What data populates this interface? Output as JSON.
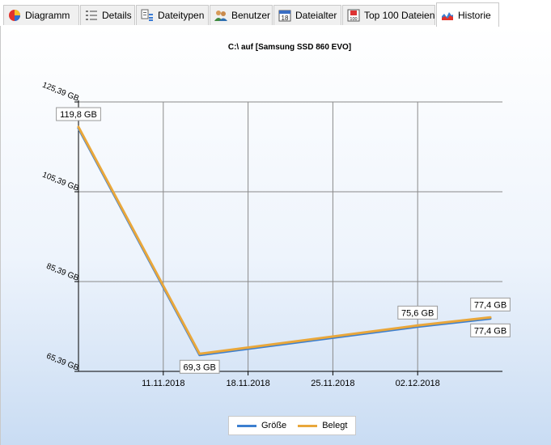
{
  "tabs": [
    {
      "label": "Diagramm",
      "icon": "pie-chart-icon",
      "active": false
    },
    {
      "label": "Details",
      "icon": "list-icon",
      "active": false
    },
    {
      "label": "Dateitypen",
      "icon": "file-types-icon",
      "active": false
    },
    {
      "label": "Benutzer",
      "icon": "users-icon",
      "active": false
    },
    {
      "label": "Dateialter",
      "icon": "calendar-icon",
      "active": false
    },
    {
      "label": "Top 100 Dateien",
      "icon": "top100-icon",
      "active": false
    },
    {
      "label": "Historie",
      "icon": "history-chart-icon",
      "active": true
    }
  ],
  "chart_data": {
    "type": "line",
    "title": "C:\\  auf  [Samsung SSD 860 EVO]",
    "xlabel": "",
    "ylabel": "",
    "x_ticks": [
      "11.11.2018",
      "18.11.2018",
      "25.11.2018",
      "02.12.2018"
    ],
    "y_ticks": [
      "65,39 GB",
      "85,39 GB",
      "105,39 GB",
      "125,39 GB"
    ],
    "x_range": [
      "2018-11-04",
      "2018-12-09"
    ],
    "ylim": [
      65.39,
      125.39
    ],
    "grid": true,
    "legend_position": "bottom",
    "series": [
      {
        "name": "Größe",
        "color": "#3c7fd0",
        "points": [
          {
            "x": "2018-11-04",
            "y": 119.8
          },
          {
            "x": "2018-11-14",
            "y": 69.3
          },
          {
            "x": "2018-12-02",
            "y": 75.6
          },
          {
            "x": "2018-12-08",
            "y": 77.4
          }
        ]
      },
      {
        "name": "Belegt",
        "color": "#e9a73b",
        "points": [
          {
            "x": "2018-11-04",
            "y": 119.8
          },
          {
            "x": "2018-11-14",
            "y": 69.3
          },
          {
            "x": "2018-12-02",
            "y": 75.6
          },
          {
            "x": "2018-12-08",
            "y": 77.4
          }
        ]
      }
    ],
    "data_labels": [
      {
        "x": "2018-11-04",
        "y": 119.8,
        "text": "119,8 GB",
        "placement": "above"
      },
      {
        "x": "2018-11-14",
        "y": 69.3,
        "text": "69,3 GB",
        "placement": "below"
      },
      {
        "x": "2018-12-02",
        "y": 75.6,
        "text": "75,6 GB",
        "placement": "above"
      },
      {
        "x": "2018-12-08",
        "y": 77.4,
        "text": "77,4 GB",
        "placement": "above"
      },
      {
        "x": "2018-12-08",
        "y": 77.4,
        "text": "77,4 GB",
        "placement": "below"
      }
    ]
  }
}
